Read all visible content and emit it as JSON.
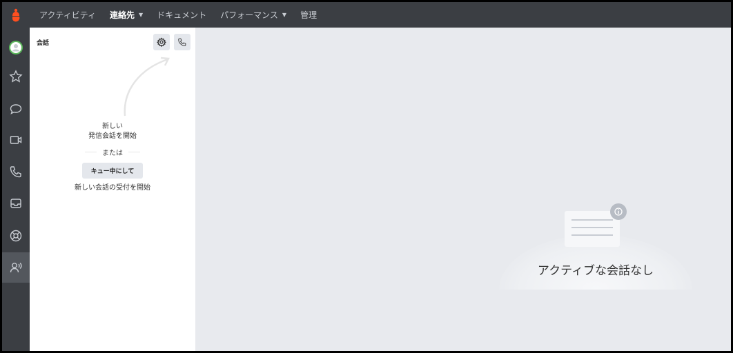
{
  "nav": {
    "items": [
      {
        "label": "アクティビティ",
        "bold": false,
        "caret": false
      },
      {
        "label": "連絡先",
        "bold": true,
        "caret": true
      },
      {
        "label": "ドキュメント",
        "bold": false,
        "caret": false
      },
      {
        "label": "パフォーマンス",
        "bold": false,
        "caret": true
      },
      {
        "label": "管理",
        "bold": false,
        "caret": false
      }
    ],
    "caret_glyph": "▼"
  },
  "rail": {
    "icons": [
      "avatar-icon",
      "star-icon",
      "chat-icon",
      "video-icon",
      "phone-icon",
      "inbox-icon",
      "support-icon",
      "agent-icon"
    ],
    "active": "agent-icon"
  },
  "panel": {
    "title": "会話",
    "hint_line1": "新しい",
    "hint_line2": "発信会話を開始",
    "or": "または",
    "queue_button": "キュー中にして",
    "inbound_hint": "新しい会話の受付を開始"
  },
  "main": {
    "empty_text": "アクティブな会話なし"
  },
  "colors": {
    "brand": "#ff4f1f",
    "topbar": "#3b3e43",
    "main_bg": "#e8eaee",
    "panel_bg": "#ffffff"
  }
}
